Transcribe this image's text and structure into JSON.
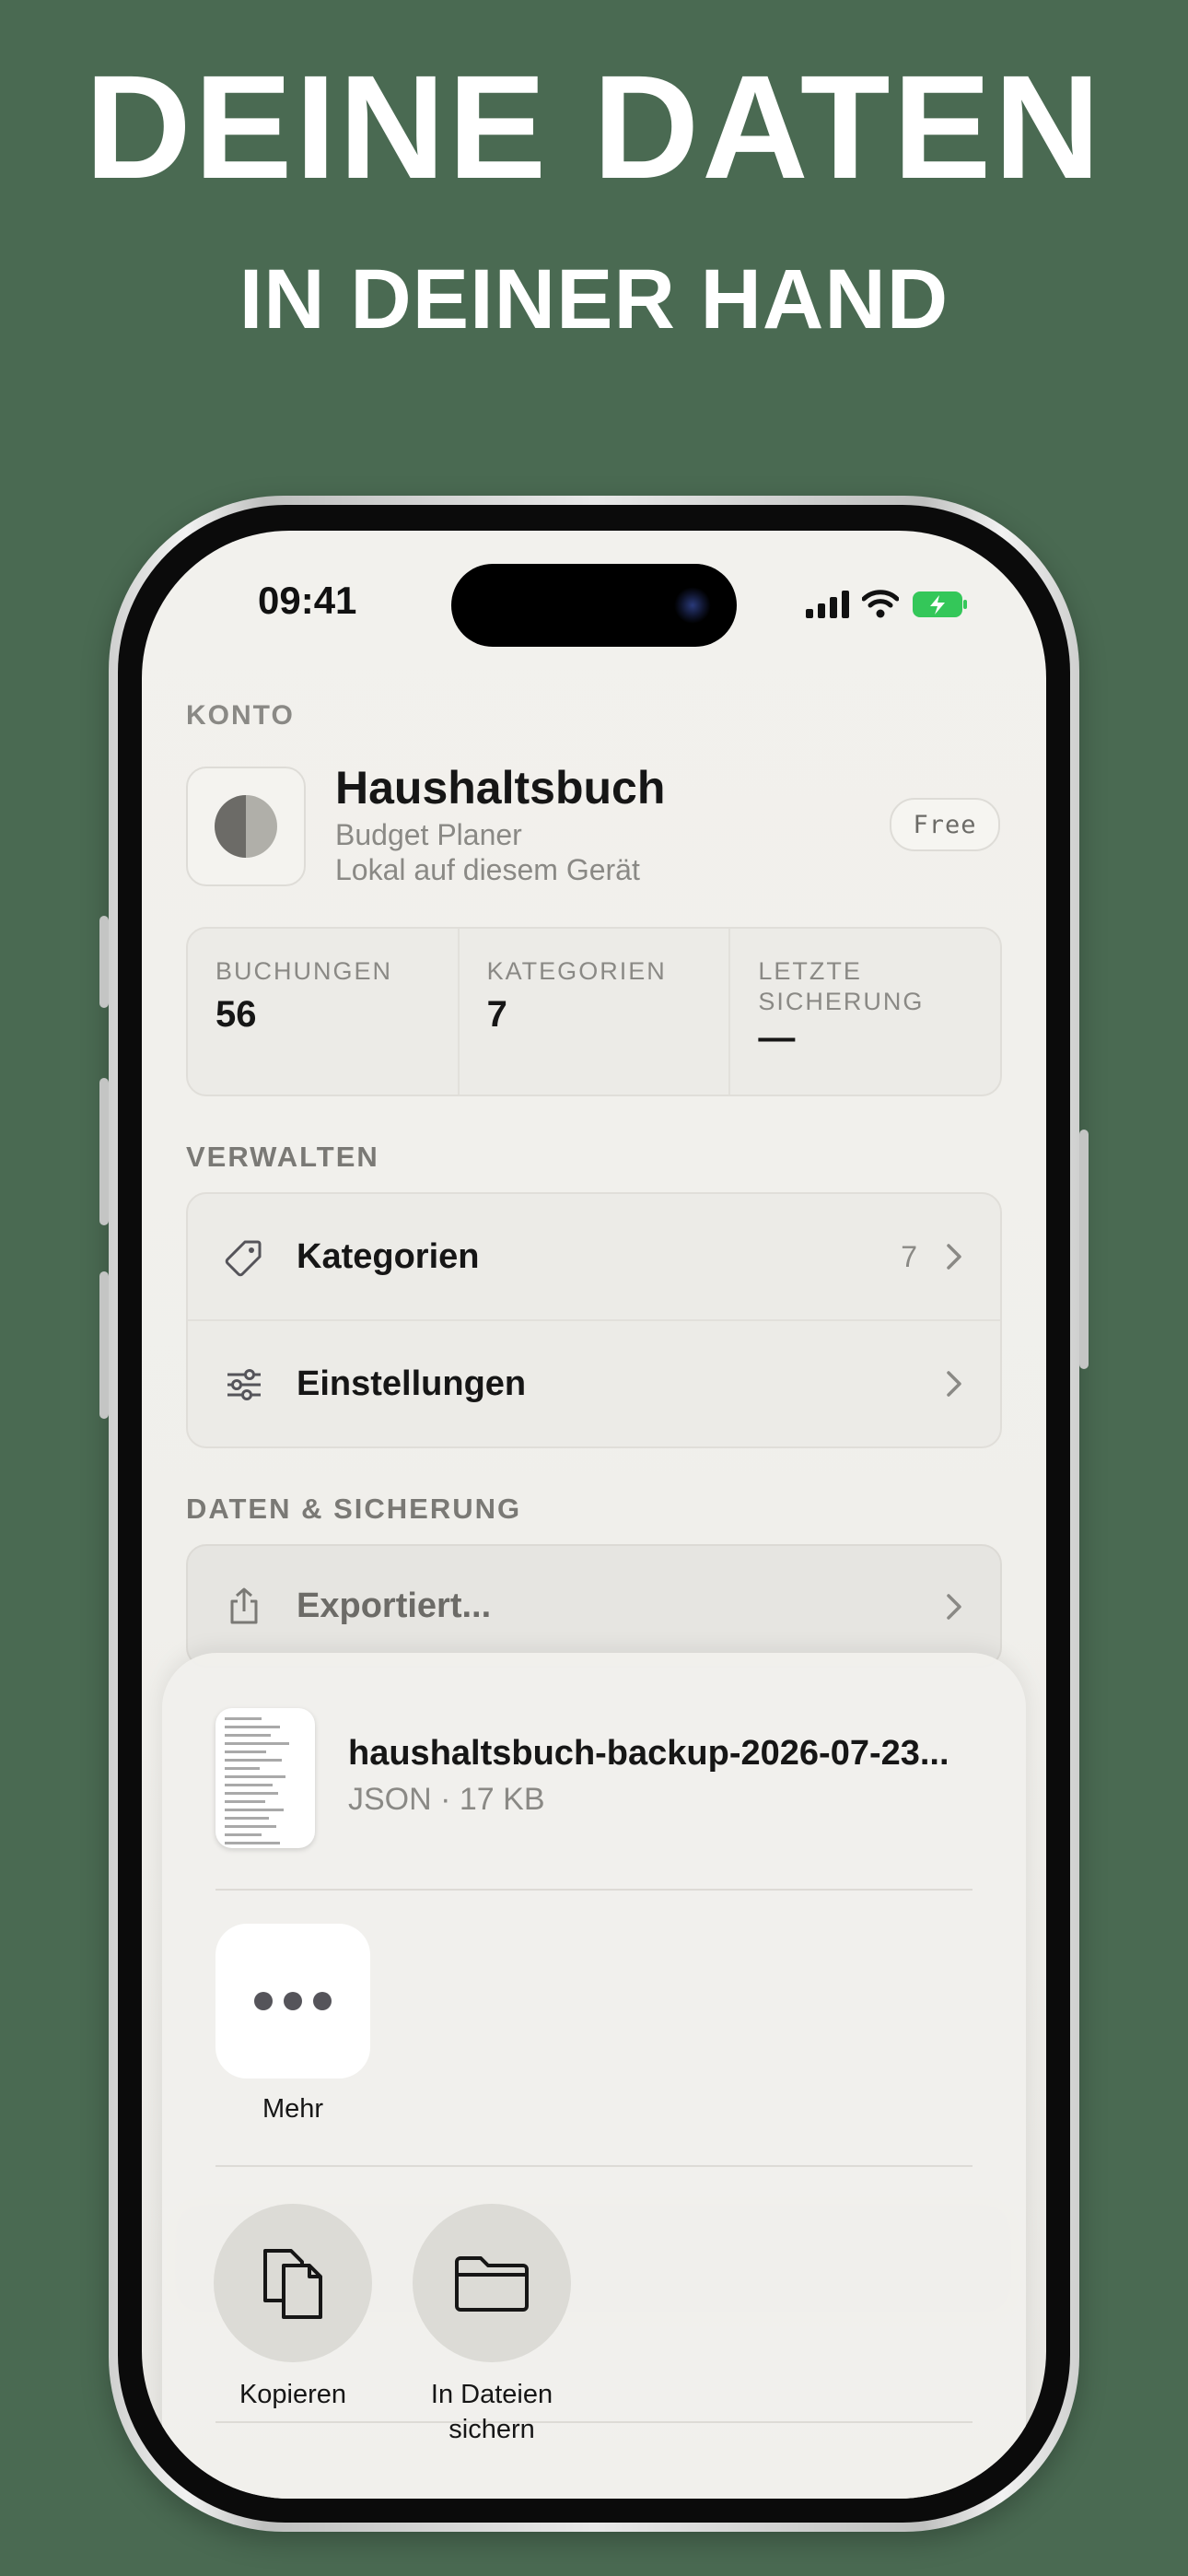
{
  "headline": {
    "line1": "DEINE DATEN",
    "line2": "IN DEINER HAND"
  },
  "status_bar": {
    "time": "09:41"
  },
  "account": {
    "section_label": "KONTO",
    "app_name": "Haushaltsbuch",
    "subtitle": "Budget Planer",
    "storage": "Lokal auf diesem Gerät",
    "plan_badge": "Free"
  },
  "stats": [
    {
      "label": "BUCHUNGEN",
      "value": "56"
    },
    {
      "label": "KATEGORIEN",
      "value": "7"
    },
    {
      "label": "LETZTE SICHERUNG",
      "value": "—"
    }
  ],
  "manage": {
    "section_label": "VERWALTEN",
    "categories_label": "Kategorien",
    "categories_count": "7",
    "settings_label": "Einstellungen"
  },
  "data_backup": {
    "section_label": "DATEN & SICHERUNG",
    "export_label": "Exportiert..."
  },
  "share_sheet": {
    "file_name": "haushaltsbuch-backup-2026-07-23...",
    "file_meta": "JSON · 17 KB",
    "more_label": "Mehr",
    "copy_label": "Kopieren",
    "save_files_label_line1": "In Dateien",
    "save_files_label_line2": "sichern"
  },
  "colors": {
    "background": "#4a6a52",
    "screen": "#f2f1ed",
    "text": "#161616",
    "muted": "#8a8985"
  }
}
